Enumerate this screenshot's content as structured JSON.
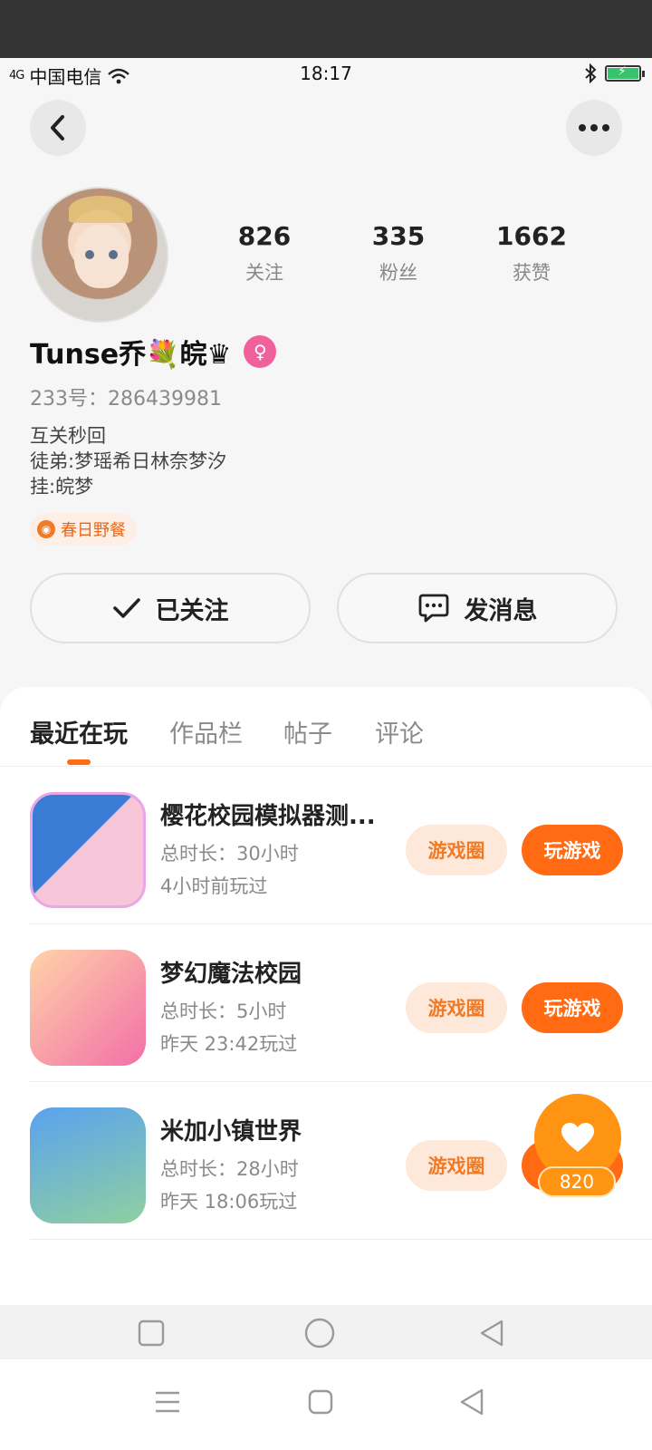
{
  "status_bar": {
    "signal": "4G",
    "carrier": "中国电信",
    "time": "18:17"
  },
  "profile": {
    "stats": [
      {
        "num": "826",
        "label": "关注"
      },
      {
        "num": "335",
        "label": "粉丝"
      },
      {
        "num": "1662",
        "label": "获赞"
      }
    ],
    "username": "Tunse乔💐皖♛",
    "gender_symbol": "♀",
    "uid": "233号：286439981",
    "bio": [
      "互关秒回",
      "徒弟:梦瑶希日林奈梦汐",
      "挂:皖梦"
    ],
    "tag": "春日野餐",
    "follow_label": "已关注",
    "message_label": "发消息"
  },
  "tabs": [
    "最近在玩",
    "作品栏",
    "帖子",
    "评论"
  ],
  "games": [
    {
      "title": "樱花校园模拟器测...",
      "duration": "总时长：30小时",
      "last_played": "4小时前玩过",
      "circle_label": "游戏圈",
      "play_label": "玩游戏"
    },
    {
      "title": "梦幻魔法校园",
      "duration": "总时长：5小时",
      "last_played": "昨天 23:42玩过",
      "circle_label": "游戏圈",
      "play_label": "玩游戏"
    },
    {
      "title": "米加小镇世界",
      "duration": "总时长：28小时",
      "last_played": "昨天 18:06玩过",
      "circle_label": "游戏圈",
      "play_label": "玩游戏"
    }
  ],
  "fab": {
    "count": "820"
  },
  "colors": {
    "accent": "#ff6a13",
    "fab": "#ff9412",
    "gender": "#f0609a"
  }
}
